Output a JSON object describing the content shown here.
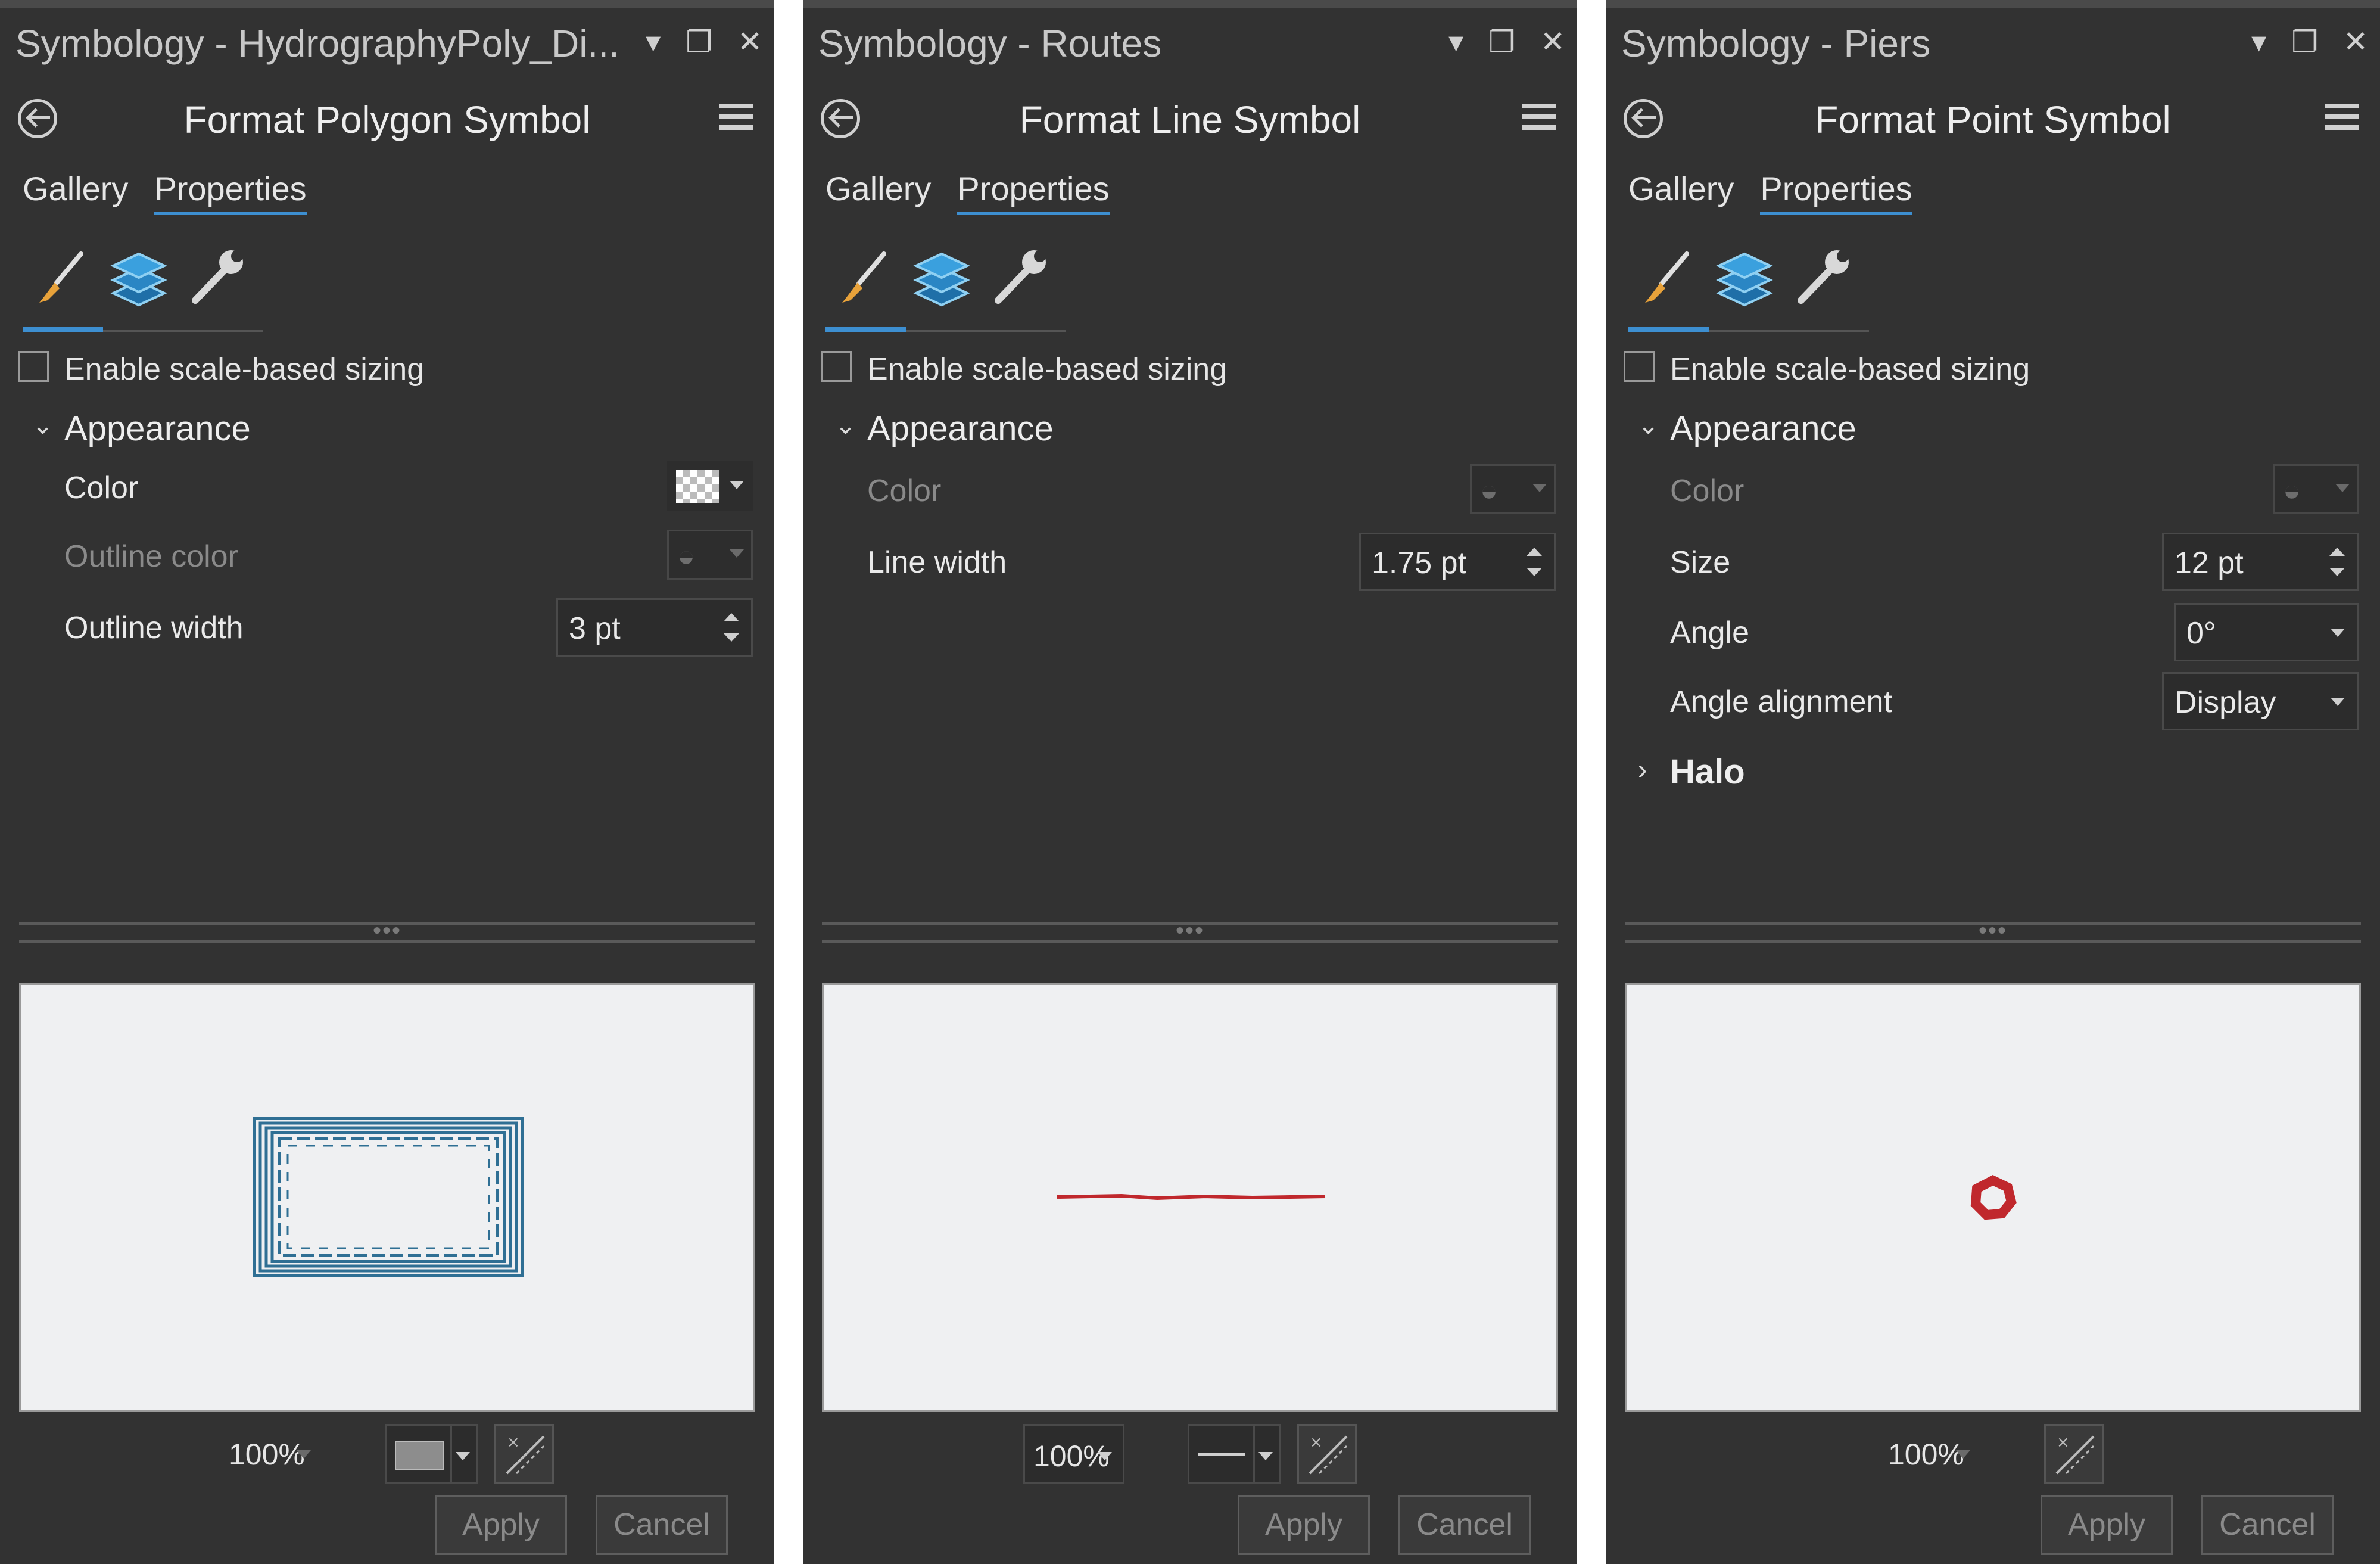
{
  "panels": [
    {
      "title": "Symbology - HydrographyPoly_Di...",
      "header": "Format Polygon Symbol",
      "tabs": [
        "Gallery",
        "Properties"
      ],
      "scale_sizing_label": "Enable scale-based sizing",
      "section": "Appearance",
      "props": [
        {
          "label": "Color",
          "control": "color"
        },
        {
          "label": "Outline color",
          "control": "color-disabled"
        },
        {
          "label": "Outline width",
          "value": "3 pt",
          "control": "spinner"
        }
      ],
      "preview_symbol": "polygon",
      "zoom": "100%",
      "apply": "Apply",
      "cancel": "Cancel"
    },
    {
      "title": "Symbology - Routes",
      "header": "Format Line Symbol",
      "tabs": [
        "Gallery",
        "Properties"
      ],
      "scale_sizing_label": "Enable scale-based sizing",
      "section": "Appearance",
      "props": [
        {
          "label": "Color",
          "control": "color-disabled"
        },
        {
          "label": "Line width",
          "value": "1.75 pt",
          "control": "spinner"
        }
      ],
      "preview_symbol": "line",
      "zoom": "100%",
      "apply": "Apply",
      "cancel": "Cancel"
    },
    {
      "title": "Symbology - Piers",
      "header": "Format Point Symbol",
      "tabs": [
        "Gallery",
        "Properties"
      ],
      "scale_sizing_label": "Enable scale-based sizing",
      "section": "Appearance",
      "props": [
        {
          "label": "Color",
          "control": "color-disabled"
        },
        {
          "label": "Size",
          "value": "12 pt",
          "control": "spinner"
        },
        {
          "label": "Angle",
          "value": "0°",
          "control": "combo"
        },
        {
          "label": "Angle alignment",
          "value": "Display",
          "control": "combo"
        }
      ],
      "collapsed_section": "Halo",
      "preview_symbol": "point",
      "zoom": "100%",
      "apply": "Apply",
      "cancel": "Cancel"
    }
  ],
  "colors": {
    "panel_bg": "#323232",
    "accent": "#3d8fd1",
    "polygon_outline": "#2f6f94",
    "line_symbol": "#c0282d",
    "point_symbol": "#c0282d"
  }
}
